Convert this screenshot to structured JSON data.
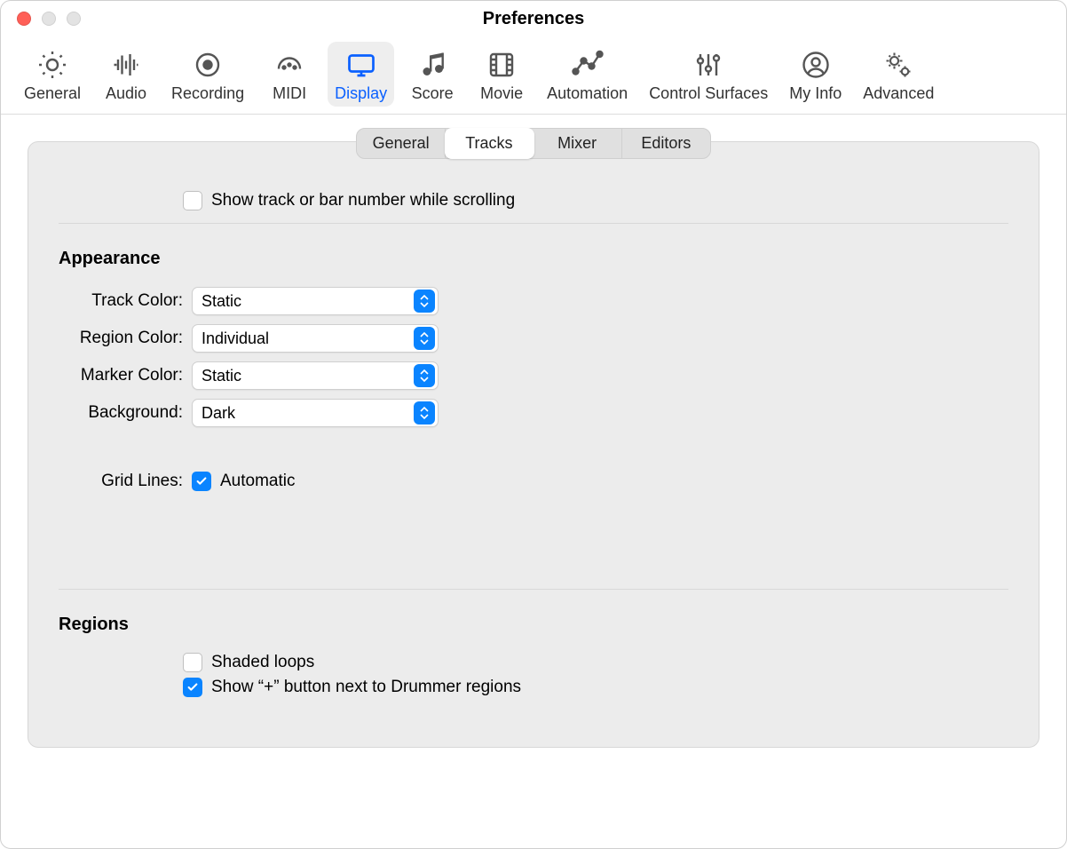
{
  "window": {
    "title": "Preferences"
  },
  "toolbar": {
    "items": [
      {
        "id": "general",
        "label": "General"
      },
      {
        "id": "audio",
        "label": "Audio"
      },
      {
        "id": "recording",
        "label": "Recording"
      },
      {
        "id": "midi",
        "label": "MIDI"
      },
      {
        "id": "display",
        "label": "Display"
      },
      {
        "id": "score",
        "label": "Score"
      },
      {
        "id": "movie",
        "label": "Movie"
      },
      {
        "id": "automation",
        "label": "Automation"
      },
      {
        "id": "surfaces",
        "label": "Control Surfaces"
      },
      {
        "id": "myinfo",
        "label": "My Info"
      },
      {
        "id": "advanced",
        "label": "Advanced"
      }
    ],
    "active": "display"
  },
  "subtabs": {
    "items": [
      {
        "id": "general",
        "label": "General"
      },
      {
        "id": "tracks",
        "label": "Tracks"
      },
      {
        "id": "mixer",
        "label": "Mixer"
      },
      {
        "id": "editors",
        "label": "Editors"
      }
    ],
    "active": "tracks"
  },
  "scroll_checkbox": {
    "label": "Show track or bar number while scrolling",
    "checked": false
  },
  "appearance": {
    "heading": "Appearance",
    "track_color": {
      "label": "Track Color:",
      "value": "Static"
    },
    "region_color": {
      "label": "Region Color:",
      "value": "Individual"
    },
    "marker_color": {
      "label": "Marker Color:",
      "value": "Static"
    },
    "background": {
      "label": "Background:",
      "value": "Dark"
    },
    "grid_lines": {
      "label": "Grid Lines:",
      "value": "Automatic",
      "checked": true
    }
  },
  "regions": {
    "heading": "Regions",
    "shaded_loops": {
      "label": "Shaded loops",
      "checked": false
    },
    "drummer_plus": {
      "label": "Show “+” button next to Drummer regions",
      "checked": true
    }
  }
}
